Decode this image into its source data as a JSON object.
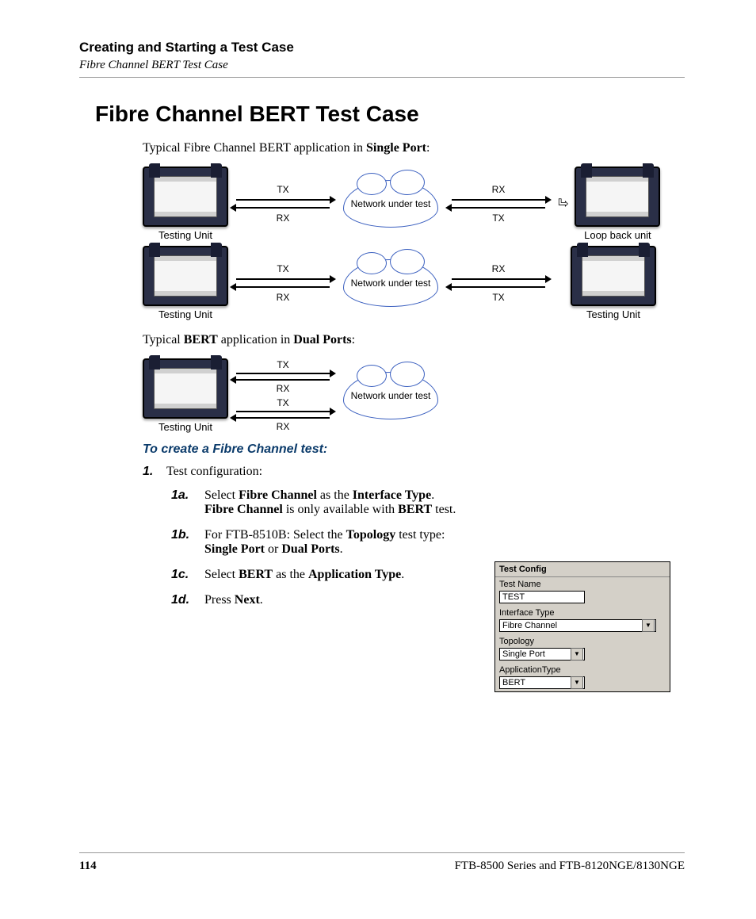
{
  "header": {
    "section": "Creating and Starting a Test Case",
    "subsection": "Fibre Channel BERT Test Case"
  },
  "title": "Fibre Channel BERT Test Case",
  "intro1_a": "Typical Fibre Channel BERT application in ",
  "intro1_b": "Single Port",
  "intro1_c": ":",
  "intro2_a": "Typical ",
  "intro2_b": "BERT",
  "intro2_c": " application in ",
  "intro2_d": "Dual Ports",
  "intro2_e": ":",
  "diagram": {
    "tx": "TX",
    "rx": "RX",
    "network": "Network under test",
    "testing_unit": "Testing Unit",
    "loop_back": "Loop back unit"
  },
  "blue_heading": "To create a Fibre Channel test:",
  "steps": {
    "s1_num": "1.",
    "s1_text": "Test configuration:",
    "s1a_num": "1a.",
    "s1a_parts": [
      "Select ",
      "Fibre Channel",
      " as the ",
      "Interface Type",
      ". ",
      "Fibre Channel",
      " is only available with ",
      "BERT",
      " test."
    ],
    "s1b_num": "1b.",
    "s1b_parts": [
      "For FTB-8510B: Select the ",
      "Topology",
      " test type: ",
      "Single Port",
      " or ",
      "Dual Ports",
      "."
    ],
    "s1c_num": "1c.",
    "s1c_parts": [
      "Select ",
      "BERT",
      " as the ",
      "Application Type",
      "."
    ],
    "s1d_num": "1d.",
    "s1d_parts": [
      "Press ",
      "Next",
      "."
    ]
  },
  "panel": {
    "title": "Test Config",
    "test_name_lbl": "Test Name",
    "test_name_val": "TEST",
    "iface_lbl": "Interface Type",
    "iface_val": "Fibre Channel",
    "topo_lbl": "Topology",
    "topo_val": "Single Port",
    "app_lbl": "ApplicationType",
    "app_val": "BERT"
  },
  "footer": {
    "page": "114",
    "doc": "FTB-8500 Series and FTB-8120NGE/8130NGE"
  }
}
